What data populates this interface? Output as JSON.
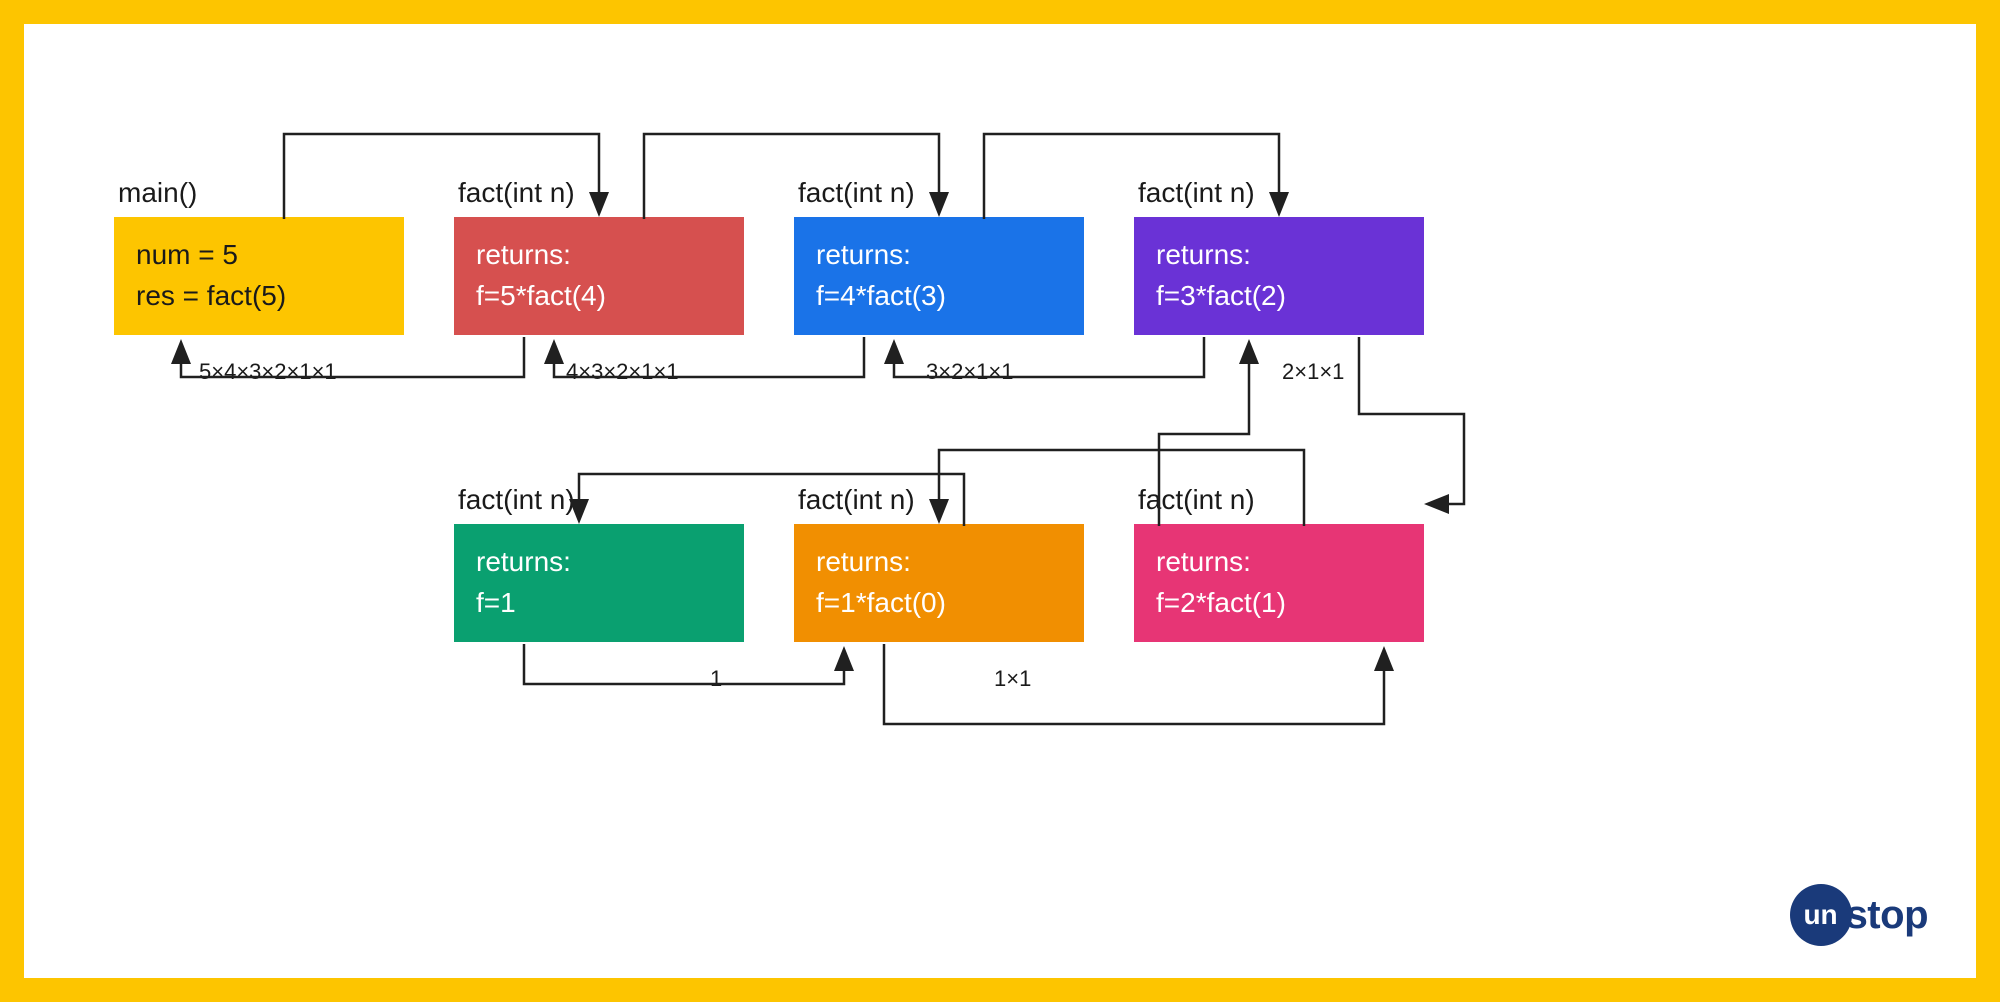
{
  "boxes": {
    "main": {
      "title": "main()",
      "line1": "num = 5",
      "line2": "res = fact(5)",
      "color": "#fdc500"
    },
    "b1": {
      "title": "fact(int n)",
      "line1": "returns:",
      "line2": "f=5*fact(4)",
      "color": "#d6504f"
    },
    "b2": {
      "title": "fact(int n)",
      "line1": "returns:",
      "line2": "f=4*fact(3)",
      "color": "#1a73e8"
    },
    "b3": {
      "title": "fact(int n)",
      "line1": "returns:",
      "line2": "f=3*fact(2)",
      "color": "#6a32d6"
    },
    "b4": {
      "title": "fact(int n)",
      "line1": "returns:",
      "line2": "f=2*fact(1)",
      "color": "#e73575"
    },
    "b5": {
      "title": "fact(int n)",
      "line1": "returns:",
      "line2": "f=1*fact(0)",
      "color": "#f18f01"
    },
    "b6": {
      "title": "fact(int n)",
      "line1": "returns:",
      "line2": "f=1",
      "color": "#0aa070"
    }
  },
  "return_labels": {
    "r1": "5×4×3×2×1×1",
    "r2": "4×3×2×1×1",
    "r3": "3×2×1×1",
    "r4": "2×1×1",
    "r5": "1×1",
    "r6": "1"
  },
  "logo": {
    "circle": "un",
    "text": "stop"
  },
  "arrow_color": "#202020"
}
